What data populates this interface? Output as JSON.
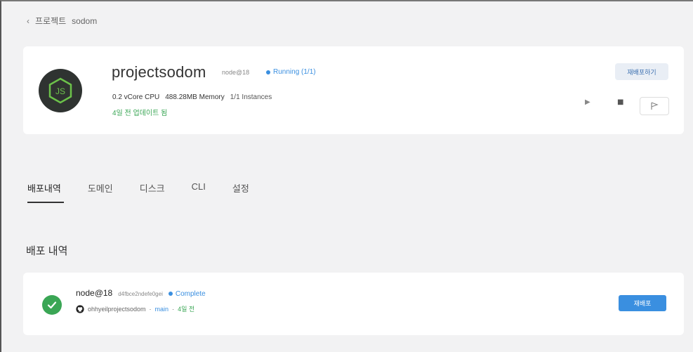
{
  "breadcrumb": {
    "parent": "프로젝트",
    "current": "sodom"
  },
  "project": {
    "name": "projectsodom",
    "runtime": "node@18",
    "status": "Running (1/1)",
    "cpu": "0.2 vCore CPU",
    "memory": "488.28MB Memory",
    "instances": "1/1 Instances",
    "updated": "4일 전 업데이트 됨",
    "deploy_button": "재배포하기"
  },
  "tabs": [
    "배포내역",
    "도메인",
    "디스크",
    "CLI",
    "설정"
  ],
  "section_title": "배포 내역",
  "deployment": {
    "name": "node@18",
    "commit": "d4fbce2ndefe0gei",
    "status": "Complete",
    "repo": "ohhyeilprojectsodom",
    "separator": "·",
    "branch": "main",
    "ago": "4일 전",
    "button": "재배포"
  },
  "colors": {
    "accent": "#3a8fe0",
    "success": "#3aa655",
    "logo_bg": "#2f3331"
  },
  "icons": [
    "chevron-left-icon",
    "nodejs-logo-icon",
    "play-icon",
    "stop-icon",
    "flag-icon",
    "check-icon",
    "github-icon"
  ]
}
